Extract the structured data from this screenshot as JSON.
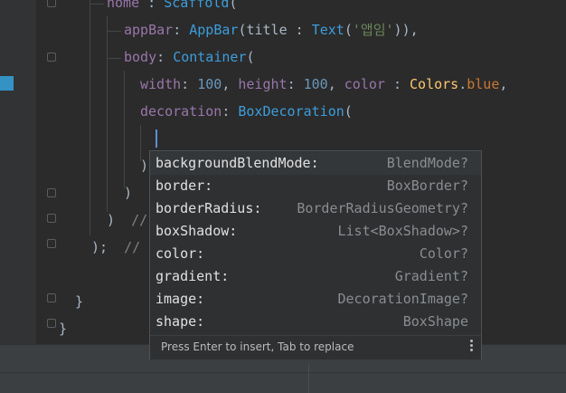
{
  "code": {
    "line1": {
      "indent": "",
      "name": "home",
      "sep": " : ",
      "cls": "Scaffold",
      "rest": "("
    },
    "line2": {
      "prop": "appBar",
      "colon": ": ",
      "cls": "AppBar",
      "open": "(title : ",
      "cls2": "Text",
      "p1": "(",
      "str": "'앱임'",
      "p2": ")),"
    },
    "line3": {
      "prop": "body",
      "colon": ": ",
      "cls": "Container",
      "open": "("
    },
    "line4": {
      "prop1": "width",
      "c1": ": ",
      "num1": "100",
      "s1": ", ",
      "prop2": "height",
      "c2": ": ",
      "num2": "100",
      "s2": ", ",
      "prop3": "color",
      "c3": " : ",
      "cls": "Colors",
      "dot": ".",
      "val": "blue",
      "end": ","
    },
    "line5": {
      "prop": "decoration",
      "colon": ": ",
      "cls": "BoxDecoration",
      "open": "("
    },
    "line7": {
      "text": ")"
    },
    "line8": {
      "text": ")"
    },
    "line9": {
      "text": ")",
      "comment": "//"
    },
    "line10": {
      "text": ");",
      "comment": "//"
    },
    "line12": {
      "text": "}"
    },
    "line13": {
      "text": "}"
    }
  },
  "autocomplete": {
    "items": [
      {
        "name": "backgroundBlendMode:",
        "type": "BlendMode?"
      },
      {
        "name": "border:",
        "type": "BoxBorder?"
      },
      {
        "name": "borderRadius:",
        "type": "BorderRadiusGeometry?"
      },
      {
        "name": "boxShadow:",
        "type": "List<BoxShadow>?"
      },
      {
        "name": "color:",
        "type": "Color?"
      },
      {
        "name": "gradient:",
        "type": "Gradient?"
      },
      {
        "name": "image:",
        "type": "DecorationImage?"
      },
      {
        "name": "shape:",
        "type": "BoxShape"
      }
    ],
    "hint": "Press Enter to insert, Tab to replace"
  }
}
